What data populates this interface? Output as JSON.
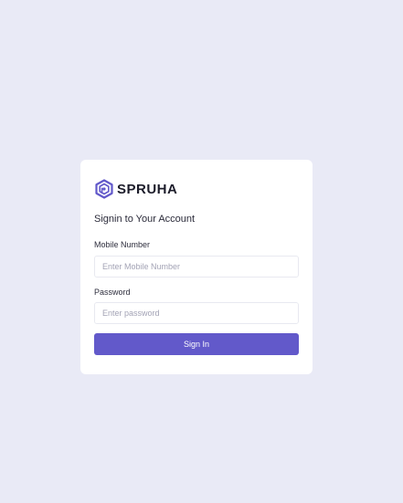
{
  "brand": {
    "name": "SPRUHA",
    "logo_icon": "hexagon-logo-icon",
    "logo_color": "#6259ca"
  },
  "form": {
    "heading": "Signin to Your Account",
    "mobile": {
      "label": "Mobile Number",
      "placeholder": "Enter Mobile Number",
      "value": ""
    },
    "password": {
      "label": "Password",
      "placeholder": "Enter password",
      "value": ""
    },
    "submit_label": "Sign In"
  },
  "colors": {
    "page_background": "#e9eaf6",
    "card_background": "#ffffff",
    "accent": "#6259ca"
  }
}
